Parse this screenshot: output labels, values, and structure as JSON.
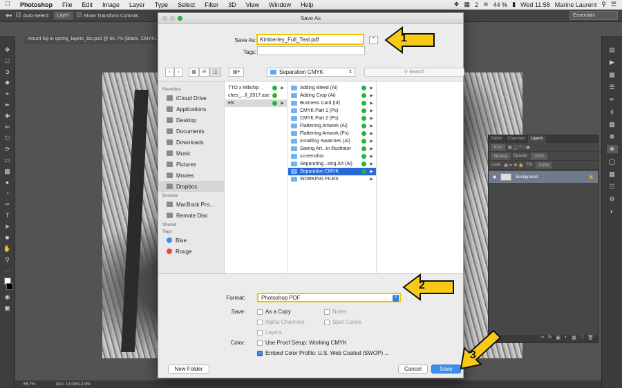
{
  "menubar": {
    "app": "Photoshop",
    "items": [
      "File",
      "Edit",
      "Image",
      "Layer",
      "Type",
      "Select",
      "Filter",
      "3D",
      "View",
      "Window",
      "Help"
    ],
    "battery": "44 %",
    "clock": "Wed 11:58",
    "user": "Marine Laurent",
    "notif_count": "2"
  },
  "options_bar": {
    "auto_select": "Auto-Select:",
    "layer_select": "Layer",
    "show_transform": "Show Transform Controls",
    "workspace": "Essentials"
  },
  "document": {
    "tab": "mount fuji in spring_layers_bis.psd @ 66.7% (Black, CMYK/..."
  },
  "status": {
    "zoom": "66.7%",
    "doc_size": "Doc: 13.0M/13.0M"
  },
  "layers_panel": {
    "tabs": [
      "Paths",
      "Channels",
      "Layers"
    ],
    "kind": "Kind",
    "blend": "Normal",
    "opacity_label": "Opacity:",
    "opacity": "100%",
    "lock_label": "Lock:",
    "fill_label": "Fill:",
    "fill": "100%",
    "layer_name": "Background"
  },
  "dialog": {
    "title": "Save As",
    "save_as_label": "Save As:",
    "filename": "Kimberley_Full_Teal.pdf",
    "tags_label": "Tags:",
    "location": "Separation CMYK",
    "search_placeholder": "Search",
    "sidebar": {
      "favorites_head": "Favorites",
      "favorites": [
        "iCloud Drive",
        "Applications",
        "Desktop",
        "Documents",
        "Downloads",
        "Music",
        "Pictures",
        "Movies",
        "Dropbox"
      ],
      "devices_head": "Devices",
      "devices": [
        "MacBook Pro...",
        "Remote Disc"
      ],
      "shared_head": "Shared",
      "tags_head": "Tags",
      "tags": [
        "Blue",
        "Rouge"
      ]
    },
    "col1": [
      "TTO x Milichip",
      "ches_...ll_2017.ase",
      "els"
    ],
    "col2": [
      "Adding Bleed (Ai)",
      "Adding Crop (Ai)",
      "Business Card (Id)",
      "CMYK Part 1 (Ps)",
      "CMYK Part 2 (Ps)",
      "Flattening Artwork (Ai)",
      "Flattening Artwork (Ps)",
      "Installing Swatches (Ai)",
      "Saving Art...in Illustrator",
      "screenshot",
      "Separating...sing Art (Ai)",
      "Separation CMYK",
      "WORKING FILES"
    ],
    "format_label": "Format:",
    "format": "Photoshop PDF",
    "save_label": "Save:",
    "color_label": "Color:",
    "save_opts": {
      "as_copy": "As a Copy",
      "notes": "Notes",
      "alpha": "Alpha Channels",
      "spot": "Spot Colors",
      "layers": "Layers"
    },
    "proof": "Use Proof Setup:  Working CMYK",
    "embed": "Embed Color Profile:  U.S. Web Coated (SWOP) ...",
    "new_folder": "New Folder",
    "cancel": "Cancel",
    "save_button": "Save"
  },
  "annotations": {
    "n1": "1",
    "n2": "2",
    "n3": "3",
    "highlight_color": "#f2c200"
  }
}
